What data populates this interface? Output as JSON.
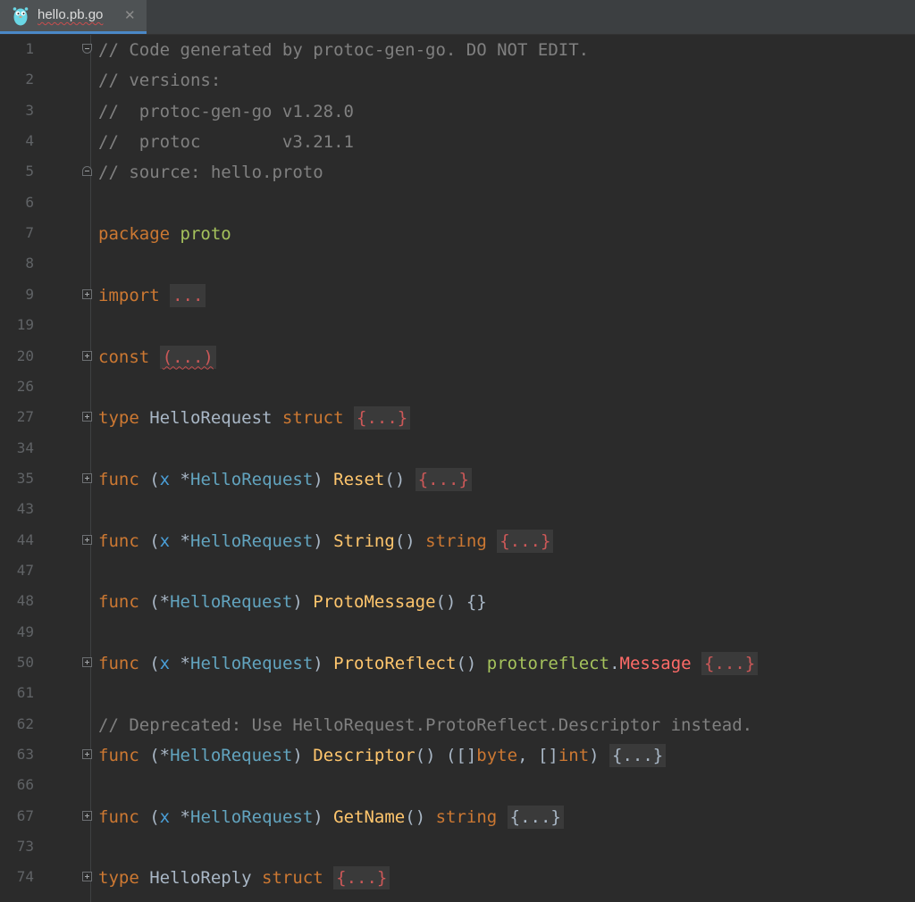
{
  "tab": {
    "title": "hello.pb.go",
    "icon": "gopher-icon",
    "close_glyph": "✕"
  },
  "lines": [
    {
      "n": "1",
      "fold": "open-top",
      "tokens": [
        {
          "c": "cm",
          "t": "// Code generated by protoc-gen-go. DO NOT EDIT."
        }
      ]
    },
    {
      "n": "2",
      "fold": "",
      "tokens": [
        {
          "c": "cm",
          "t": "// versions:"
        }
      ]
    },
    {
      "n": "3",
      "fold": "",
      "tokens": [
        {
          "c": "cm",
          "t": "//  protoc-gen-go v1.28.0"
        }
      ]
    },
    {
      "n": "4",
      "fold": "",
      "tokens": [
        {
          "c": "cm",
          "t": "//  protoc        v3.21.1"
        }
      ]
    },
    {
      "n": "5",
      "fold": "open-bottom",
      "tokens": [
        {
          "c": "cm",
          "t": "// source: hello.proto"
        }
      ]
    },
    {
      "n": "6",
      "fold": "",
      "tokens": []
    },
    {
      "n": "7",
      "fold": "",
      "tokens": [
        {
          "c": "kw",
          "t": "package "
        },
        {
          "c": "pkg",
          "t": "proto"
        }
      ]
    },
    {
      "n": "8",
      "fold": "",
      "tokens": []
    },
    {
      "n": "9",
      "fold": "plus",
      "tokens": [
        {
          "c": "kw",
          "t": "import "
        },
        {
          "c": "fb",
          "t": "..."
        }
      ]
    },
    {
      "n": "19",
      "fold": "",
      "tokens": []
    },
    {
      "n": "20",
      "fold": "plus",
      "tokens": [
        {
          "c": "kw",
          "t": "const "
        },
        {
          "c": "fb wavy",
          "t": "(...)"
        }
      ]
    },
    {
      "n": "26",
      "fold": "",
      "tokens": []
    },
    {
      "n": "27",
      "fold": "plus",
      "tokens": [
        {
          "c": "kw",
          "t": "type "
        },
        {
          "c": "ty",
          "t": "HelloRequest "
        },
        {
          "c": "kw",
          "t": "struct "
        },
        {
          "c": "fb",
          "t": "{...}"
        }
      ]
    },
    {
      "n": "34",
      "fold": "",
      "tokens": []
    },
    {
      "n": "35",
      "fold": "plus",
      "tokens": [
        {
          "c": "kw",
          "t": "func "
        },
        {
          "c": "pl",
          "t": "("
        },
        {
          "c": "rx",
          "t": "x "
        },
        {
          "c": "pl",
          "t": "*"
        },
        {
          "c": "id",
          "t": "HelloRequest"
        },
        {
          "c": "pl",
          "t": ") "
        },
        {
          "c": "fn",
          "t": "Reset"
        },
        {
          "c": "pl",
          "t": "() "
        },
        {
          "c": "fb",
          "t": "{...}"
        }
      ]
    },
    {
      "n": "43",
      "fold": "",
      "tokens": []
    },
    {
      "n": "44",
      "fold": "plus",
      "tokens": [
        {
          "c": "kw",
          "t": "func "
        },
        {
          "c": "pl",
          "t": "("
        },
        {
          "c": "rx",
          "t": "x "
        },
        {
          "c": "pl",
          "t": "*"
        },
        {
          "c": "id",
          "t": "HelloRequest"
        },
        {
          "c": "pl",
          "t": ") "
        },
        {
          "c": "fn",
          "t": "String"
        },
        {
          "c": "pl",
          "t": "() "
        },
        {
          "c": "kw",
          "t": "string "
        },
        {
          "c": "fb",
          "t": "{...}"
        }
      ]
    },
    {
      "n": "47",
      "fold": "",
      "tokens": []
    },
    {
      "n": "48",
      "fold": "",
      "tokens": [
        {
          "c": "kw",
          "t": "func "
        },
        {
          "c": "pl",
          "t": "(*"
        },
        {
          "c": "id",
          "t": "HelloRequest"
        },
        {
          "c": "pl",
          "t": ") "
        },
        {
          "c": "fn",
          "t": "ProtoMessage"
        },
        {
          "c": "pl",
          "t": "() {}"
        }
      ]
    },
    {
      "n": "49",
      "fold": "",
      "tokens": []
    },
    {
      "n": "50",
      "fold": "plus",
      "tokens": [
        {
          "c": "kw",
          "t": "func "
        },
        {
          "c": "pl",
          "t": "("
        },
        {
          "c": "rx",
          "t": "x "
        },
        {
          "c": "pl",
          "t": "*"
        },
        {
          "c": "id",
          "t": "HelloRequest"
        },
        {
          "c": "pl",
          "t": ") "
        },
        {
          "c": "fn",
          "t": "ProtoReflect"
        },
        {
          "c": "pl",
          "t": "() "
        },
        {
          "c": "pkg",
          "t": "protoreflect"
        },
        {
          "c": "pl",
          "t": "."
        },
        {
          "c": "red",
          "t": "Message "
        },
        {
          "c": "fb",
          "t": "{...}"
        }
      ]
    },
    {
      "n": "61",
      "fold": "",
      "tokens": []
    },
    {
      "n": "62",
      "fold": "",
      "tokens": [
        {
          "c": "cm",
          "t": "// Deprecated: Use HelloRequest.ProtoReflect.Descriptor instead."
        }
      ]
    },
    {
      "n": "63",
      "fold": "plus",
      "tokens": [
        {
          "c": "kw",
          "t": "func "
        },
        {
          "c": "pl",
          "t": "(*"
        },
        {
          "c": "id",
          "t": "HelloRequest"
        },
        {
          "c": "pl",
          "t": ") "
        },
        {
          "c": "fn",
          "t": "Descriptor"
        },
        {
          "c": "pl",
          "t": "() ([]"
        },
        {
          "c": "kw",
          "t": "byte"
        },
        {
          "c": "pl",
          "t": ", []"
        },
        {
          "c": "kw",
          "t": "int"
        },
        {
          "c": "pl",
          "t": ") "
        },
        {
          "c": "fb gray",
          "t": "{...}"
        }
      ]
    },
    {
      "n": "66",
      "fold": "",
      "tokens": []
    },
    {
      "n": "67",
      "fold": "plus",
      "tokens": [
        {
          "c": "kw",
          "t": "func "
        },
        {
          "c": "pl",
          "t": "("
        },
        {
          "c": "rx",
          "t": "x "
        },
        {
          "c": "pl",
          "t": "*"
        },
        {
          "c": "id",
          "t": "HelloRequest"
        },
        {
          "c": "pl",
          "t": ") "
        },
        {
          "c": "fn",
          "t": "GetName"
        },
        {
          "c": "pl",
          "t": "() "
        },
        {
          "c": "kw",
          "t": "string "
        },
        {
          "c": "fb gray",
          "t": "{...}"
        }
      ]
    },
    {
      "n": "73",
      "fold": "",
      "tokens": []
    },
    {
      "n": "74",
      "fold": "plus",
      "tokens": [
        {
          "c": "kw",
          "t": "type "
        },
        {
          "c": "ty",
          "t": "HelloReply "
        },
        {
          "c": "kw",
          "t": "struct "
        },
        {
          "c": "fb",
          "t": "{...}"
        }
      ]
    }
  ]
}
